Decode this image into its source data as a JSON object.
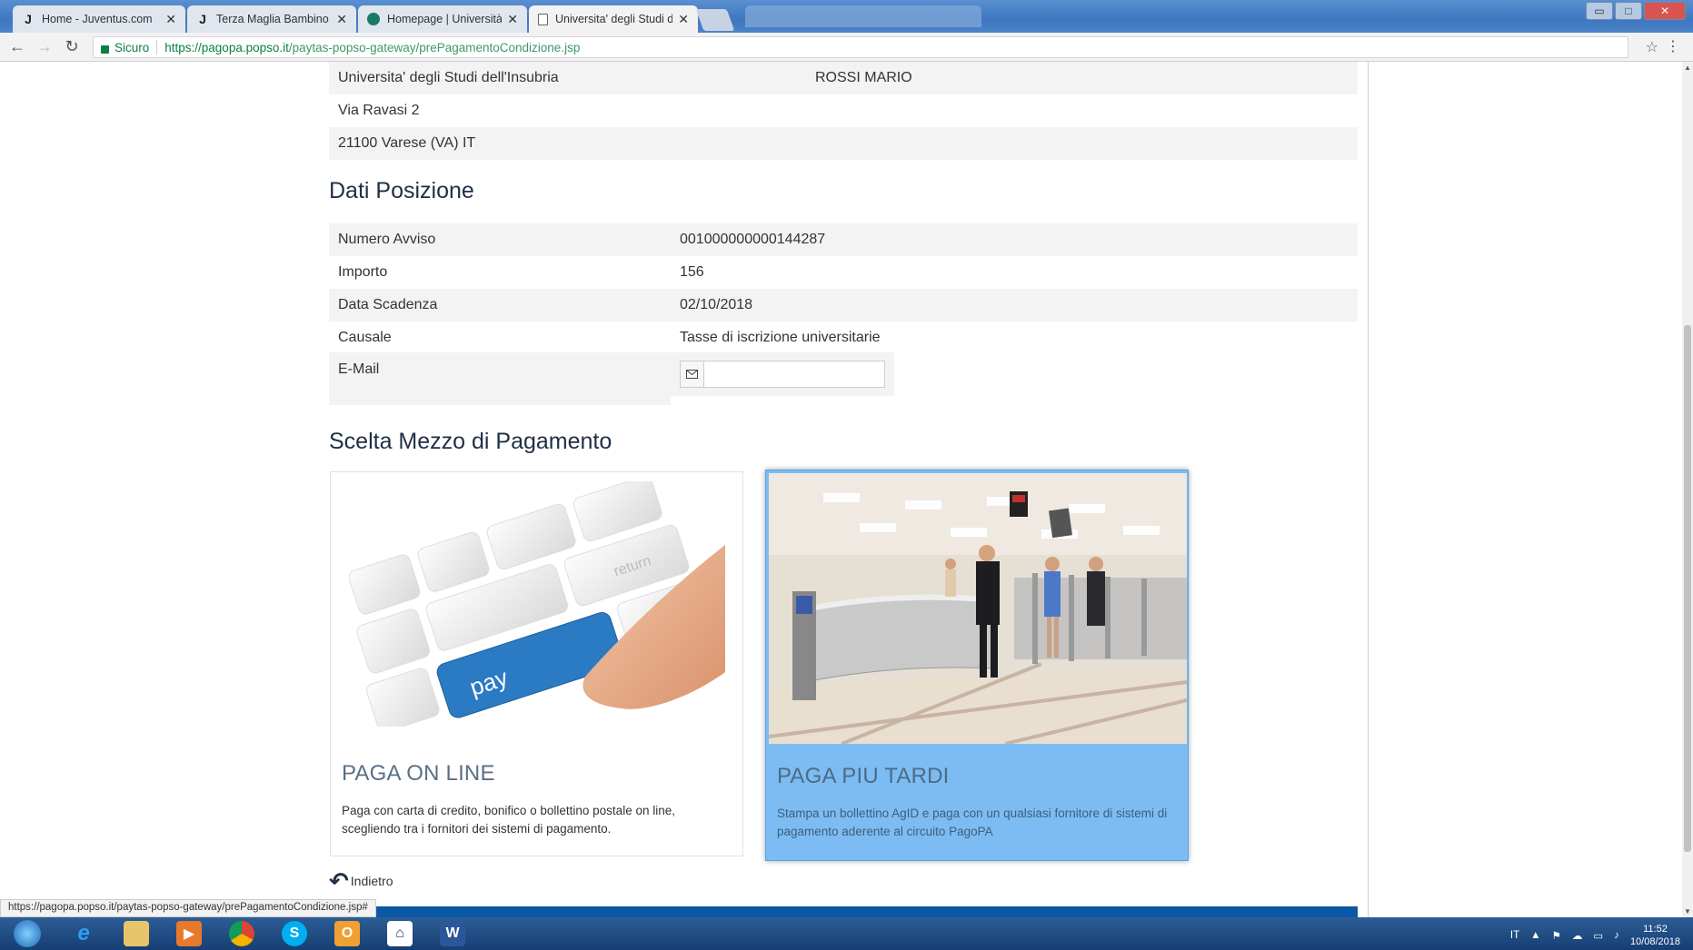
{
  "browser": {
    "tabs": [
      {
        "title": "Home - Juventus.com",
        "icon": "J"
      },
      {
        "title": "Terza Maglia Bambino Ju",
        "icon": "J"
      },
      {
        "title": "Homepage | Università d",
        "icon": "globe"
      },
      {
        "title": "Universita' degli Studi de",
        "icon": "doc",
        "active": true
      }
    ],
    "close_glyph": "✕",
    "secure_label": "Sicuro",
    "url_host": "https://pagopa.popso.it",
    "url_path": "/paytas-popso-gateway/prePagamentoCondizione.jsp",
    "window_buttons": {
      "restore": "▭",
      "maximize": "□",
      "close": "✕"
    }
  },
  "creditor": {
    "name": "Universita' degli Studi dell'Insubria",
    "debtor": "ROSSI MARIO",
    "address": "Via Ravasi 2",
    "city": "21100 Varese (VA) IT"
  },
  "position": {
    "heading": "Dati Posizione",
    "rows": [
      {
        "label": "Numero Avviso",
        "value": "001000000000144287"
      },
      {
        "label": "Importo",
        "value": "156"
      },
      {
        "label": "Data Scadenza",
        "value": "02/10/2018"
      },
      {
        "label": "Causale",
        "value": "Tasse di iscrizione universitarie"
      }
    ],
    "email_label": "E-Mail",
    "email_value": "",
    "email_icon": "envelope-icon"
  },
  "payment": {
    "heading": "Scelta Mezzo di Pagamento",
    "online": {
      "title": "PAGA ON LINE",
      "description": "Paga con carta di credito, bonifico o bollettino postale on line, scegliendo tra i fornitori dei sistemi di pagamento.",
      "key_label": "pay",
      "return_label": "return"
    },
    "later": {
      "title": "PAGA PIU TARDI",
      "description": "Stampa un bollettino AgID e paga con un qualsiasi fornitore di sistemi di pagamento aderente al circuito PagoPA"
    }
  },
  "back_label": "Indietro",
  "status_url": "https://pagopa.popso.it/paytas-popso-gateway/prePagamentoCondizione.jsp#",
  "taskbar": {
    "lang": "IT",
    "time": "11:52",
    "date": "10/08/2018"
  },
  "colors": {
    "accent_blue": "#0a57a5",
    "later_card": "#7cbcf2",
    "heading": "#1f2f46"
  }
}
